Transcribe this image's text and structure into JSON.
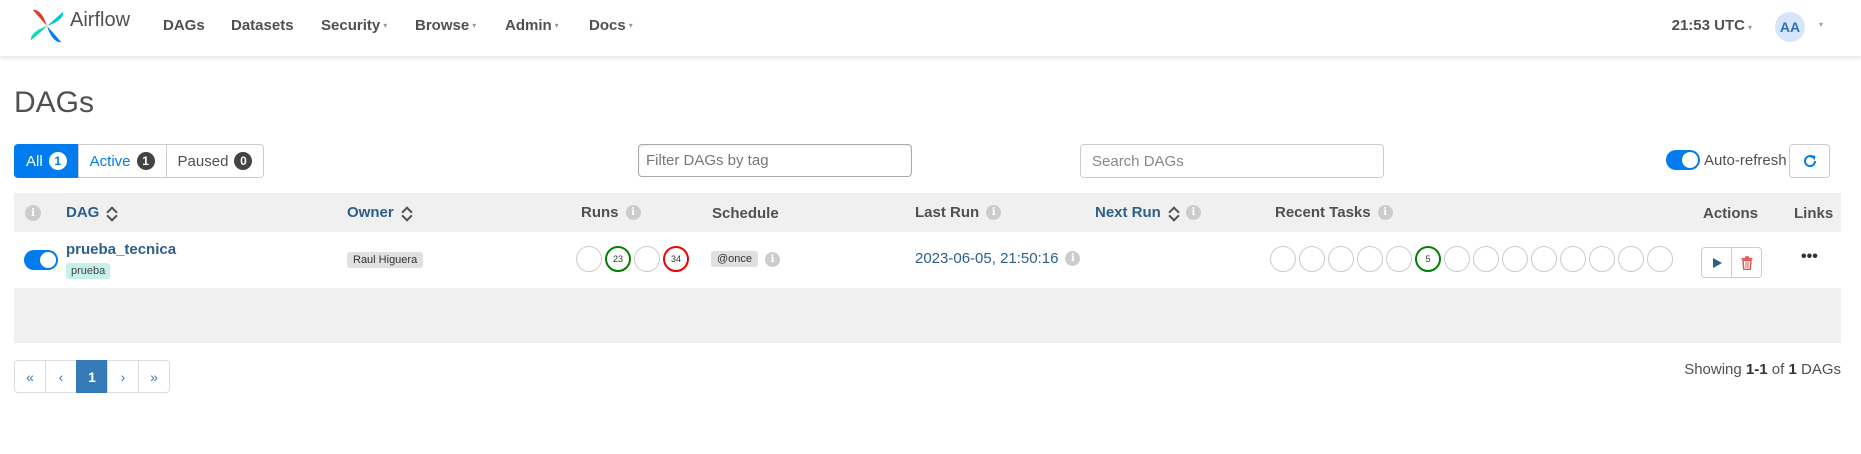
{
  "colors": {
    "accent": "#017cee",
    "link": "#2d5f8b",
    "success": "#008000",
    "failed": "#ee0000"
  },
  "navbar": {
    "brand": "Airflow",
    "items": [
      {
        "label": "DAGs",
        "has_caret": false
      },
      {
        "label": "Datasets",
        "has_caret": false
      },
      {
        "label": "Security",
        "has_caret": true
      },
      {
        "label": "Browse",
        "has_caret": true
      },
      {
        "label": "Admin",
        "has_caret": true
      },
      {
        "label": "Docs",
        "has_caret": true
      }
    ],
    "clock": "21:53 UTC",
    "user_initials": "AA"
  },
  "page": {
    "title": "DAGs"
  },
  "filters": {
    "all": {
      "label": "All",
      "count": "1"
    },
    "active": {
      "label": "Active",
      "count": "1"
    },
    "paused": {
      "label": "Paused",
      "count": "0"
    },
    "tag_placeholder": "Filter DAGs by tag",
    "search_placeholder": "Search DAGs",
    "autorefresh_label": "Auto-refresh",
    "autorefresh_on": true
  },
  "table": {
    "headers": {
      "dag": "DAG",
      "owner": "Owner",
      "runs": "Runs",
      "schedule": "Schedule",
      "last_run": "Last Run",
      "next_run": "Next Run",
      "recent_tasks": "Recent Tasks",
      "actions": "Actions",
      "links": "Links"
    },
    "rows": [
      {
        "dag_id": "prueba_tecnica",
        "tag": "prueba",
        "owner": "Raul Higuera",
        "runs": {
          "success": "23",
          "failed": "34"
        },
        "schedule": "@once",
        "last_run": "2023-06-05, 21:50:16",
        "next_run": "",
        "recent_tasks_success": "5",
        "links": "•••"
      }
    ]
  },
  "pagination": {
    "first": "«",
    "prev": "‹",
    "current": "1",
    "next": "›",
    "last": "»"
  },
  "footer": {
    "showing_prefix": "Showing",
    "range": "1-1",
    "of": "of",
    "total": "1",
    "suffix": "DAGs"
  }
}
